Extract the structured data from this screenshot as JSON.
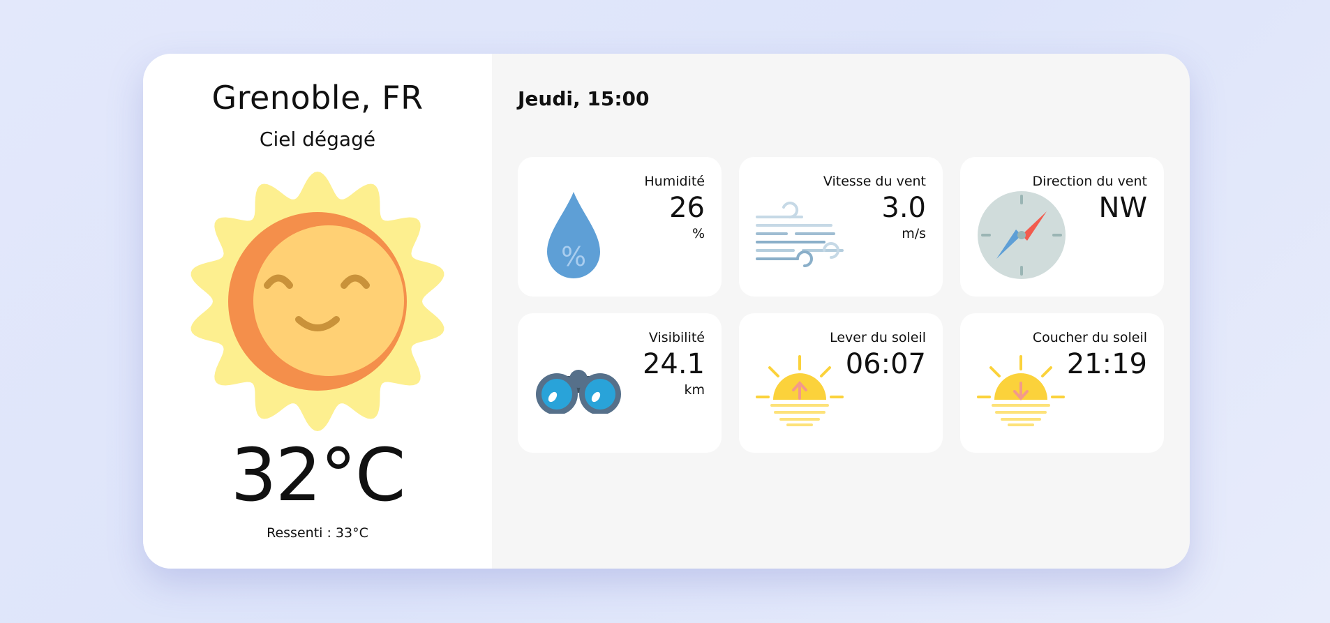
{
  "location": {
    "city": "Grenoble, FR",
    "condition": "Ciel dégagé"
  },
  "current": {
    "temperature": "32°C",
    "feels_like": "Ressenti : 33°C",
    "icon": "smiling-sun-icon"
  },
  "datetime": "Jeudi, 15:00",
  "metrics": [
    {
      "label": "Humidité",
      "value": "26",
      "unit": "%",
      "icon": "humidity-drop-icon"
    },
    {
      "label": "Vitesse du vent",
      "value": "3.0",
      "unit": "m/s",
      "icon": "wind-icon"
    },
    {
      "label": "Direction du vent",
      "value": "NW",
      "unit": "",
      "icon": "compass-icon"
    },
    {
      "label": "Visibilité",
      "value": "24.1",
      "unit": "km",
      "icon": "binoculars-icon"
    },
    {
      "label": "Lever du soleil",
      "value": "06:07",
      "unit": "",
      "icon": "sunrise-icon"
    },
    {
      "label": "Coucher du soleil",
      "value": "21:19",
      "unit": "",
      "icon": "sunset-icon"
    }
  ],
  "colors": {
    "sun_rays": "#fdef8f",
    "sun_face": "#ffd074",
    "sun_shade": "#f48f4b",
    "drop": "#5e9fd6",
    "compass_face": "#d0dcdb",
    "needle_north": "#f25b4d",
    "needle_south": "#5e9fd6",
    "binoculars_lens": "#29a3d9",
    "sunrise_sun": "#fbd23b",
    "arrow": "#f39a8a"
  }
}
